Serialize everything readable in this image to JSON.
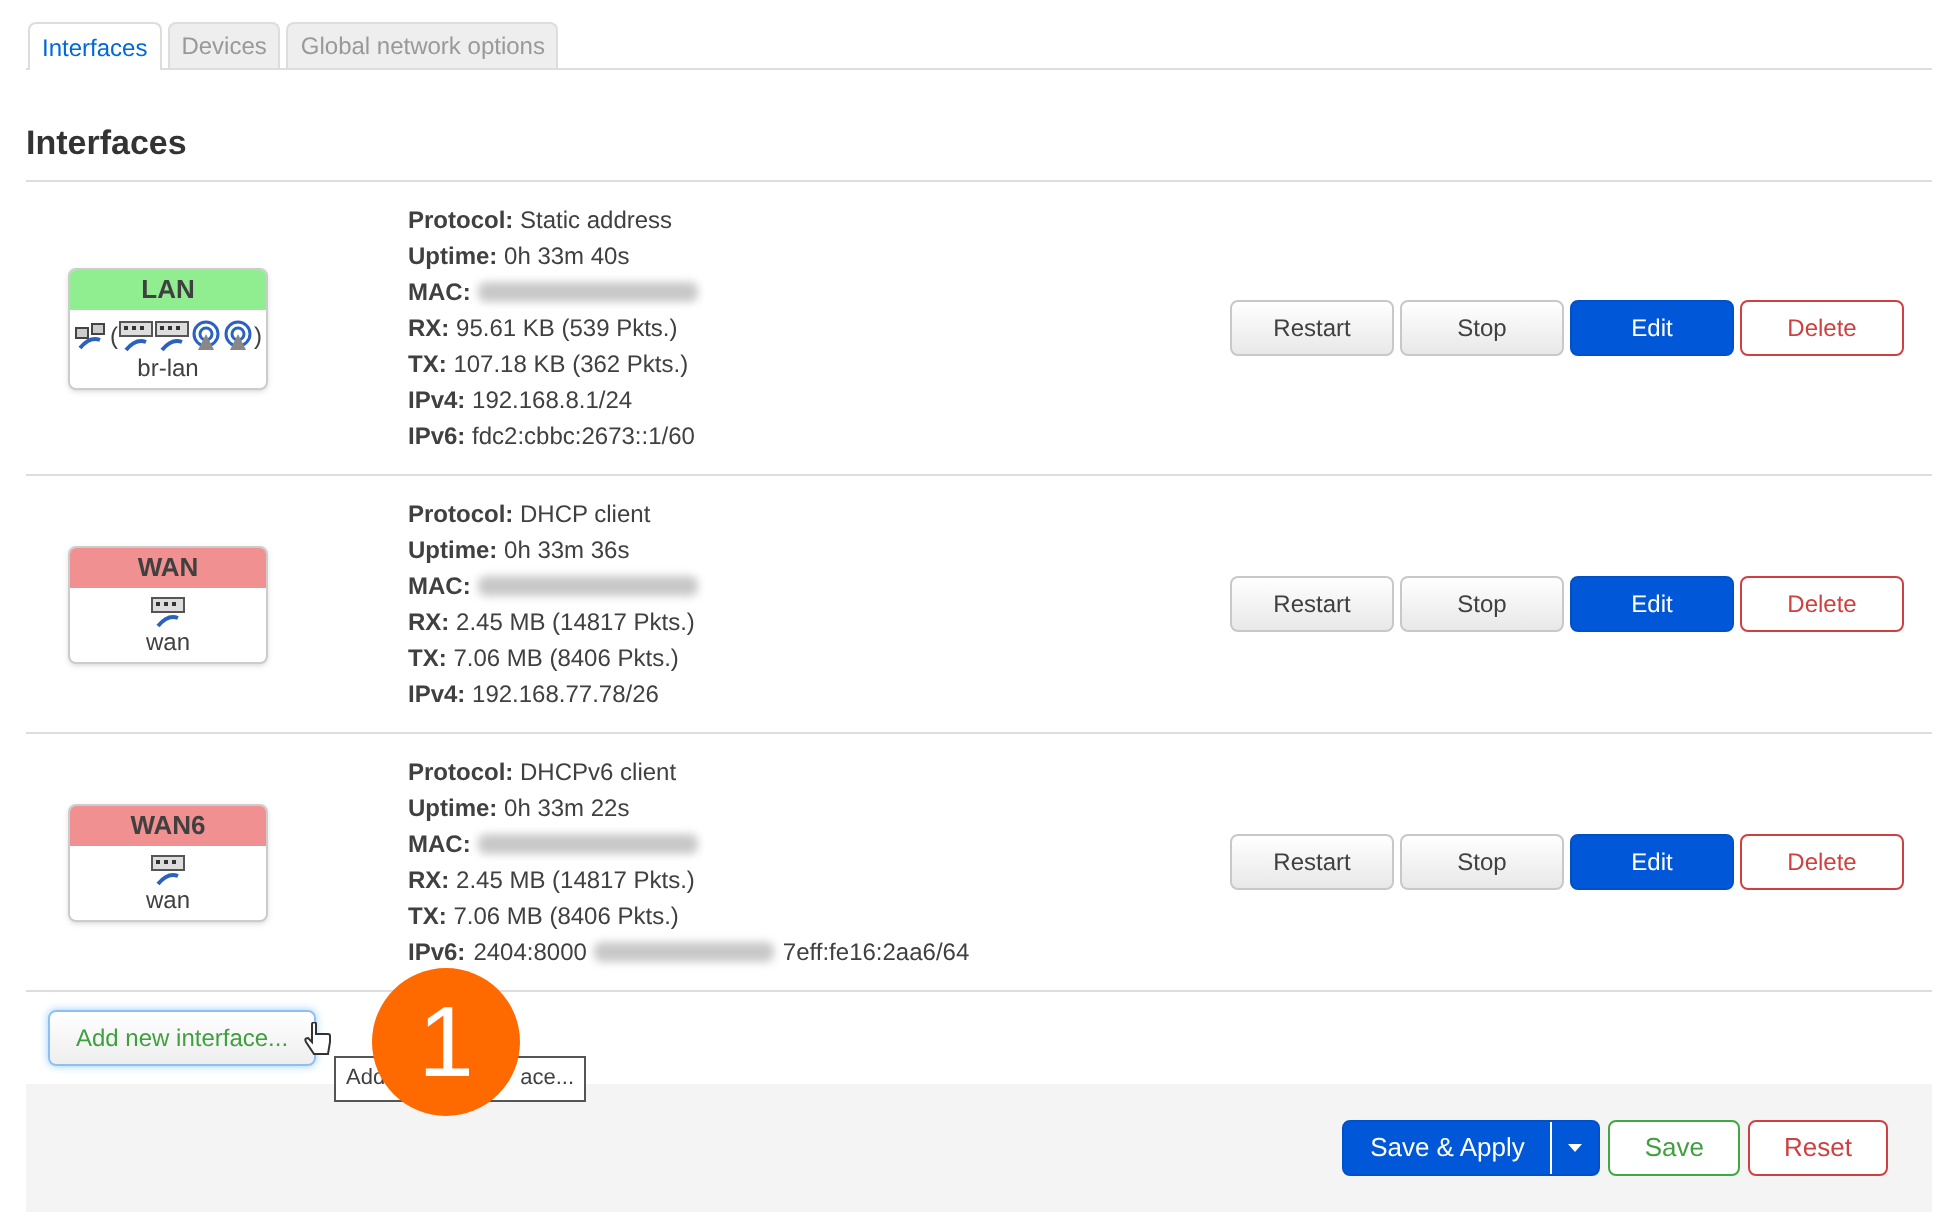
{
  "tabs": [
    {
      "label": "Interfaces",
      "selected": true
    },
    {
      "label": "Devices",
      "selected": false
    },
    {
      "label": "Global network options",
      "selected": false
    }
  ],
  "heading": "Interfaces",
  "interfaces": [
    {
      "name": "LAN",
      "up": true,
      "bridge": true,
      "open": "(",
      "close": ")",
      "members": [
        {
          "kind": "ethernet"
        },
        {
          "kind": "ethernet"
        },
        {
          "kind": "wifi"
        },
        {
          "kind": "wifi"
        }
      ],
      "device": "br-lan",
      "info": [
        {
          "kind": "plain",
          "label": "Protocol:",
          "value": "Static address"
        },
        {
          "kind": "plain",
          "label": "Uptime:",
          "value": "0h 33m 40s"
        },
        {
          "kind": "blurred",
          "label": "MAC:"
        },
        {
          "kind": "plain",
          "label": "RX:",
          "value": "95.61 KB (539 Pkts.)"
        },
        {
          "kind": "plain",
          "label": "TX:",
          "value": "107.18 KB (362 Pkts.)"
        },
        {
          "kind": "plain",
          "label": "IPv4:",
          "value": "192.168.8.1/24"
        },
        {
          "kind": "plain",
          "label": "IPv6:",
          "value": "fdc2:cbbc:2673::1/60"
        }
      ],
      "actions": [
        {
          "kind": "default",
          "label": "Restart"
        },
        {
          "kind": "default",
          "label": "Stop"
        },
        {
          "kind": "primary",
          "label": "Edit"
        },
        {
          "kind": "danger",
          "label": "Delete"
        }
      ]
    },
    {
      "name": "WAN",
      "up": false,
      "bridge": false,
      "members": [
        {
          "kind": "ethernet"
        }
      ],
      "device": "wan",
      "info": [
        {
          "kind": "plain",
          "label": "Protocol:",
          "value": "DHCP client"
        },
        {
          "kind": "plain",
          "label": "Uptime:",
          "value": "0h 33m 36s"
        },
        {
          "kind": "blurred",
          "label": "MAC:"
        },
        {
          "kind": "plain",
          "label": "RX:",
          "value": "2.45 MB (14817 Pkts.)"
        },
        {
          "kind": "plain",
          "label": "TX:",
          "value": "7.06 MB (8406 Pkts.)"
        },
        {
          "kind": "plain",
          "label": "IPv4:",
          "value": "192.168.77.78/26"
        }
      ],
      "actions": [
        {
          "kind": "default",
          "label": "Restart"
        },
        {
          "kind": "default",
          "label": "Stop"
        },
        {
          "kind": "primary",
          "label": "Edit"
        },
        {
          "kind": "danger",
          "label": "Delete"
        }
      ]
    },
    {
      "name": "WAN6",
      "up": false,
      "bridge": false,
      "members": [
        {
          "kind": "ethernet"
        }
      ],
      "device": "wan",
      "info": [
        {
          "kind": "plain",
          "label": "Protocol:",
          "value": "DHCPv6 client"
        },
        {
          "kind": "plain",
          "label": "Uptime:",
          "value": "0h 33m 22s"
        },
        {
          "kind": "blurred",
          "label": "MAC:"
        },
        {
          "kind": "plain",
          "label": "RX:",
          "value": "2.45 MB (14817 Pkts.)"
        },
        {
          "kind": "plain",
          "label": "TX:",
          "value": "7.06 MB (8406 Pkts.)"
        },
        {
          "kind": "partly_blurred",
          "label": "IPv6:",
          "before": "2404:8000",
          "after": "7eff:fe16:2aa6/64"
        }
      ],
      "actions": [
        {
          "kind": "default",
          "label": "Restart"
        },
        {
          "kind": "default",
          "label": "Stop"
        },
        {
          "kind": "primary",
          "label": "Edit"
        },
        {
          "kind": "danger",
          "label": "Delete"
        }
      ]
    }
  ],
  "add_button": "Add new interface...",
  "tooltip": {
    "start": "Add",
    "end": "ace..."
  },
  "step_badge": "1",
  "footer": {
    "buttons": [
      {
        "kind": "primary_split",
        "label": "Save & Apply"
      },
      {
        "kind": "positive",
        "label": "Save"
      },
      {
        "kind": "danger",
        "label": "Reset"
      }
    ]
  }
}
